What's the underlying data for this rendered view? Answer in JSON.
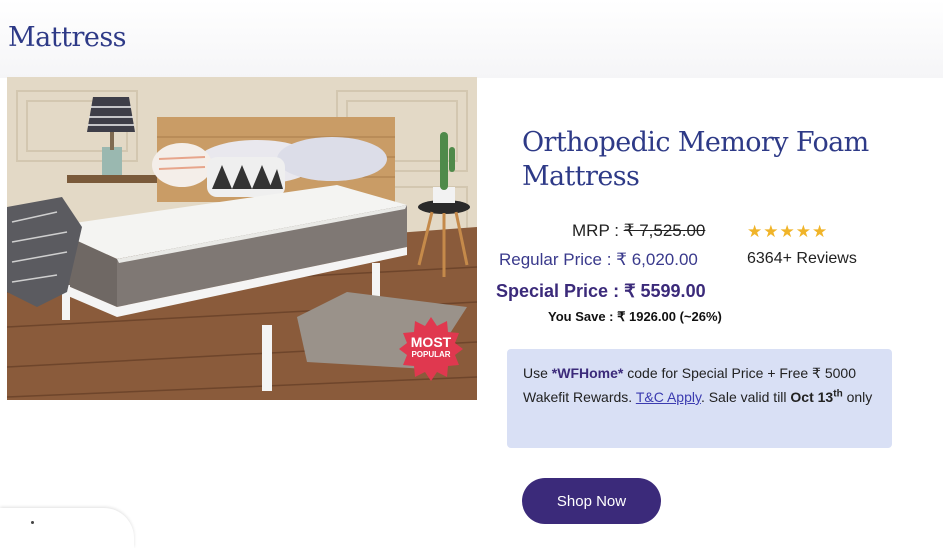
{
  "page": {
    "title": "Mattress"
  },
  "product": {
    "name": "Orthopedic Memory Foam Mattress",
    "badge_line1": "MOST",
    "badge_line2": "POPULAR",
    "mrp_label": "MRP :",
    "mrp_value": "₹ 7,525.00",
    "regular_price": "Regular Price : ₹ 6,020.00",
    "special_price": "Special Price : ₹ 5599.00",
    "you_save": "You Save : ₹ 1926.00 (~26%)",
    "rating_stars": "★★★★★",
    "rating_value": 5,
    "reviews": "6364+ Reviews"
  },
  "offer": {
    "use": "Use ",
    "code": "*WFHome*",
    "text1": " code for Special Price + Free ₹ 5000 Wakefit Rewards. ",
    "tc_link": "T&C Apply",
    "text2": ". Sale valid till ",
    "date": "Oct 13",
    "date_sup": "th",
    "text3": " only"
  },
  "actions": {
    "shop_now": "Shop Now"
  },
  "colors": {
    "brand_navy": "#2e3a87",
    "button_purple": "#3b2a7a",
    "offer_bg": "#d9e0f5",
    "star": "#f0b429",
    "badge_red": "#e0384f"
  }
}
